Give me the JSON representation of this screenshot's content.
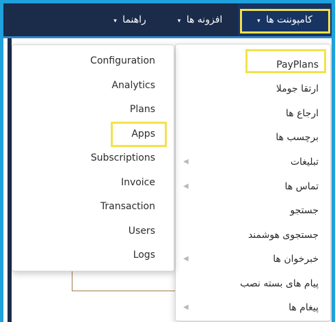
{
  "topbar": {
    "components_label": "کامپوننت ها",
    "extensions_label": "افزونه ها",
    "help_label": "راهنما",
    "caret": "▾"
  },
  "components_menu": {
    "items": [
      {
        "label": "PayPlans",
        "has_submenu": false
      },
      {
        "label": "ارتقا جوملا",
        "has_submenu": false
      },
      {
        "label": "ارجاع ها",
        "has_submenu": false
      },
      {
        "label": "برچسب ها",
        "has_submenu": false
      },
      {
        "label": "تبلیغات",
        "has_submenu": true
      },
      {
        "label": "تماس ها",
        "has_submenu": true
      },
      {
        "label": "جستجو",
        "has_submenu": false
      },
      {
        "label": "جستجوی هوشمند",
        "has_submenu": false
      },
      {
        "label": "خبرخوان ها",
        "has_submenu": true
      },
      {
        "label": "پیام های بسته نصب",
        "has_submenu": false
      },
      {
        "label": "پیغام ها",
        "has_submenu": true
      }
    ],
    "submenu_arrow": "◀"
  },
  "payplans_submenu": {
    "items": [
      {
        "label": "Configuration"
      },
      {
        "label": "Analytics"
      },
      {
        "label": "Plans"
      },
      {
        "label": "Apps"
      },
      {
        "label": "Subscriptions"
      },
      {
        "label": "Invoice"
      },
      {
        "label": "Transaction"
      },
      {
        "label": "Users"
      },
      {
        "label": "Logs"
      }
    ]
  },
  "colors": {
    "frame_border": "#1ea1dd",
    "topbar": "#1b2b4a",
    "active_nav": "#173463",
    "highlight": "#f3e24a"
  }
}
